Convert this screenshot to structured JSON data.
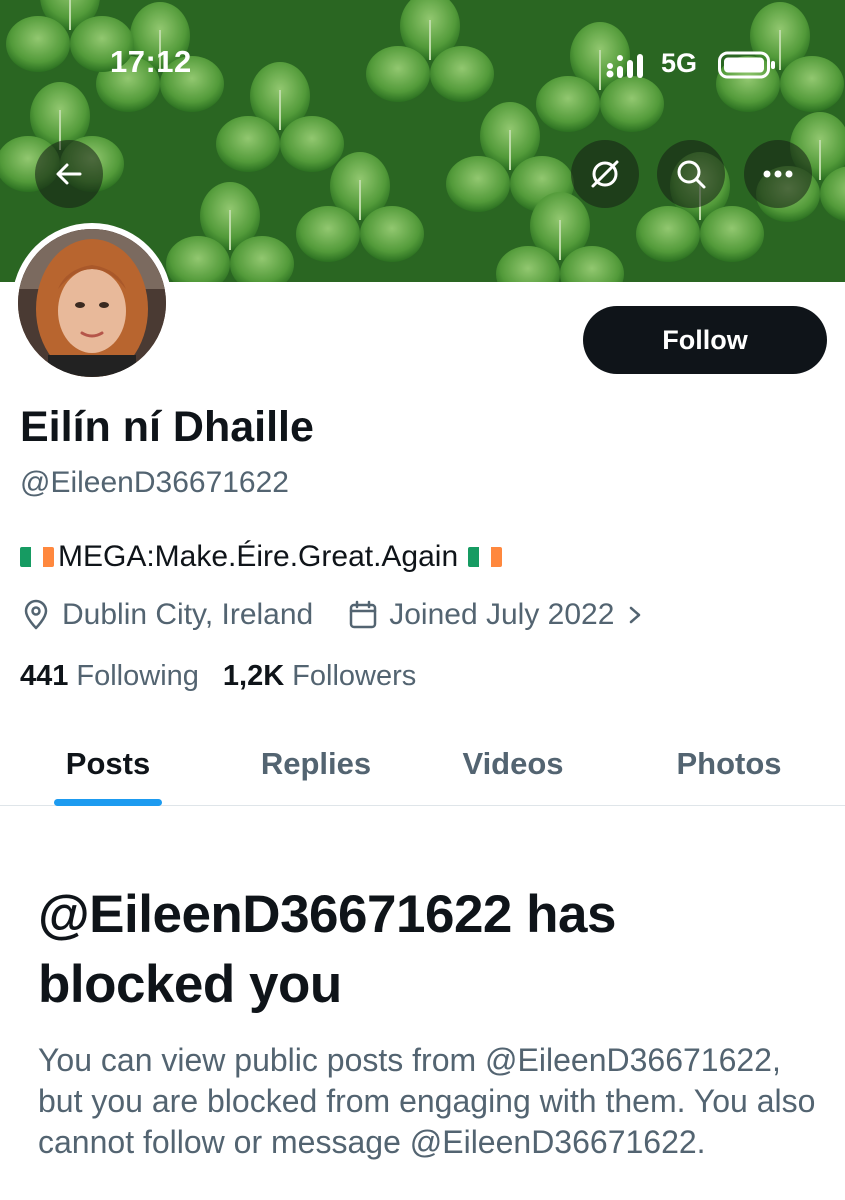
{
  "status_bar": {
    "time": "17:12",
    "network": "5G"
  },
  "header": {
    "back_icon": "arrow-left-icon",
    "rebrand_icon": "grok-slash-icon",
    "search_icon": "search-icon",
    "more_icon": "more-horizontal-icon"
  },
  "profile": {
    "display_name": "Eilín ní Dhaille",
    "handle": "@EileenD36671622",
    "bio_text": "MEGA:Make.Éire.Great.Again",
    "location": "Dublin City, Ireland",
    "joined": "Joined July 2022",
    "following_count": "441",
    "following_label": "Following",
    "followers_count": "1,2K",
    "followers_label": "Followers",
    "follow_label": "Follow"
  },
  "tabs": [
    {
      "label": "Posts",
      "active": true
    },
    {
      "label": "Replies",
      "active": false
    },
    {
      "label": "Videos",
      "active": false
    },
    {
      "label": "Photos",
      "active": false
    }
  ],
  "blocked_notice": {
    "title": "@EileenD36671622 has blocked you",
    "description": "You can view public posts from @EileenD36671622, but you are blocked from engaging with them. You also cannot follow or message @EileenD36671622."
  },
  "colors": {
    "accent": "#1d9bf0",
    "text_primary": "#0f1419",
    "text_secondary": "#536471",
    "flag_green": "#169b62",
    "flag_white": "#ffffff",
    "flag_orange": "#ff883e"
  }
}
